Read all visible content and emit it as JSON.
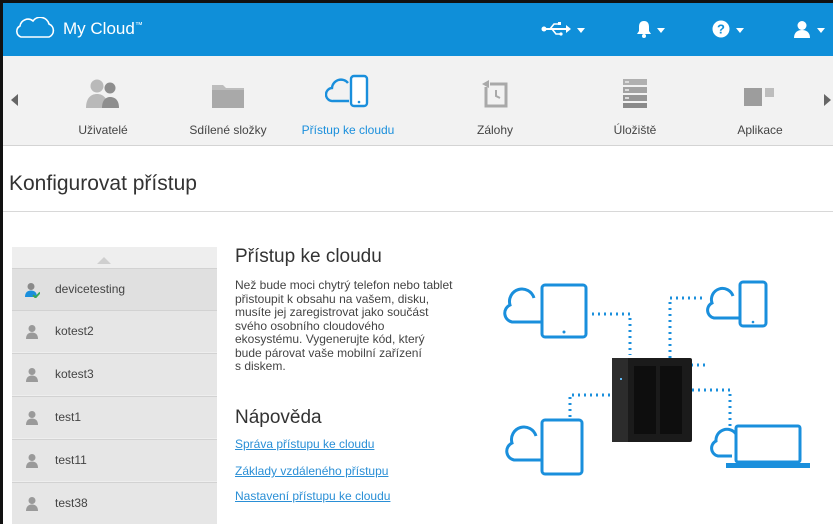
{
  "app": {
    "title": "My Cloud",
    "title_mark": "™"
  },
  "topbar": {
    "usb": "usb-icon",
    "notifications": "bell-icon",
    "help": "help-icon",
    "user": "user-icon",
    "accent": "#0f8fd9"
  },
  "nav": {
    "items": [
      {
        "label": "Uživatelé",
        "icon": "users-icon"
      },
      {
        "label": "Sdílené složky",
        "icon": "folder-icon"
      },
      {
        "label": "Přístup ke cloudu",
        "icon": "cloud-device-icon",
        "active": true
      },
      {
        "label": "Zálohy",
        "icon": "backup-icon"
      },
      {
        "label": "Úložiště",
        "icon": "storage-icon"
      },
      {
        "label": "Aplikace",
        "icon": "apps-icon"
      }
    ],
    "active_color": "#1a8fdc"
  },
  "page": {
    "title": "Konfigurovat přístup"
  },
  "devices": [
    {
      "name": "devicetesting",
      "status": "active"
    },
    {
      "name": "kotest2"
    },
    {
      "name": "kotest3"
    },
    {
      "name": "test1"
    },
    {
      "name": "test11"
    },
    {
      "name": "test38"
    }
  ],
  "content": {
    "heading": "Přístup ke cloudu",
    "description_lines": [
      "Než bude moci chytrý telefon nebo tablet",
      "přistoupit k obsahu na vašem, disku,",
      "musíte jej zaregistrovat jako součást",
      "svého osobního cloudového",
      "ekosystému. Vygenerujte kód, který",
      "bude párovat vaše mobilní zařízení",
      "s diskem."
    ],
    "help_heading": "Nápověda",
    "links": [
      "Správa přístupu ke cloudu",
      "Základy vzdáleného přístupu",
      "Nastavení přístupu ke cloudu"
    ]
  }
}
